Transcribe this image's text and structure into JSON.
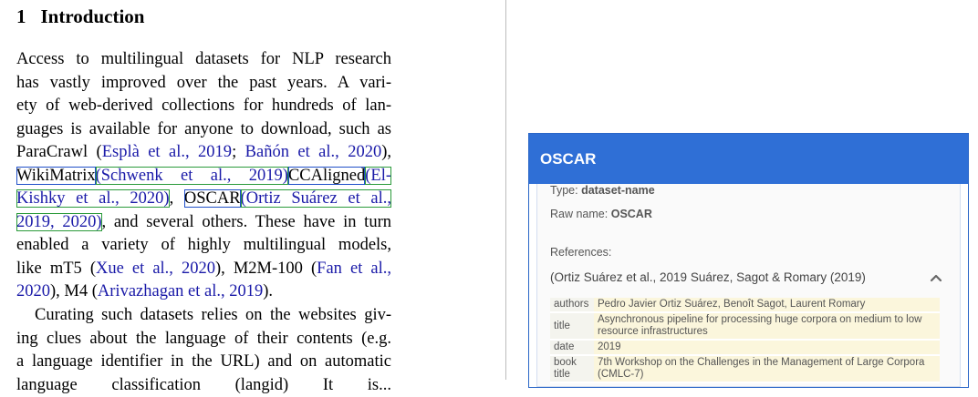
{
  "section": {
    "number": "1",
    "title": "Introduction"
  },
  "paragraph1": {
    "l1": "Access to multilingual datasets for NLP research",
    "l2": "has vastly improved over the past years.  A vari-",
    "l3": "ety of web-derived collections for hundreds of lan-",
    "l4": "guages is available for anyone to download, such as",
    "l5_pre": "ParaCrawl (",
    "l5_cite1": "Esplà et al., 2019",
    "l5_mid": "; ",
    "l5_cite2": "Bañón et al., 2020",
    "l5_post": "),",
    "l6_ent1": "WikiMatrix",
    "l6_cite1": "(Schwenk et al., 2019)",
    "l6_ent2": "CCAligned",
    "l6_cite2": "(El-",
    "l7_cite": "Kishky et al., 2020)",
    "l7_sep": ", ",
    "l7_ent": "OSCAR",
    "l7_cite2": "(Ortiz Suárez et al.,",
    "l8_cite": "2019, 2020)",
    "l8_post": ", and several others. These have in turn",
    "l9": "enabled a variety of highly multilingual models,",
    "l10_pre": "like mT5 (",
    "l10_cite1": "Xue et al., 2020",
    "l10_mid": "), M2M-100 (",
    "l10_cite2": "Fan et al.,",
    "l11_cite": "2020",
    "l11_mid": "), M4 (",
    "l11_cite2": "Arivazhagan et al., 2019",
    "l11_post": ")."
  },
  "paragraph2": {
    "l1": "Curating such datasets relies on the websites giv-",
    "l2": "ing clues about the language of their contents (e.g.",
    "l3": "a language identifier in the URL) and on automatic",
    "l4": "language classification (langid) It is..."
  },
  "panel": {
    "title": "OSCAR",
    "type_label": "Type:",
    "type_value": "dataset-name",
    "raw_label": "Raw name:",
    "raw_value": "OSCAR",
    "references_label": "References:",
    "reference_text": "(Ortiz Suárez et al., 2019 Suárez, Sagot & Romary (2019)",
    "details": [
      {
        "key": "authors",
        "value": "Pedro Javier Ortiz Suárez, Benoît Sagot, Laurent Romary"
      },
      {
        "key": "title",
        "value": "Asynchronous pipeline for processing huge corpora on medium to low resource infrastructures"
      },
      {
        "key": "date",
        "value": "2019"
      },
      {
        "key": "book title",
        "value": "7th Workshop on the Challenges in the Management of Large Corpora (CMLC-7)"
      }
    ]
  }
}
